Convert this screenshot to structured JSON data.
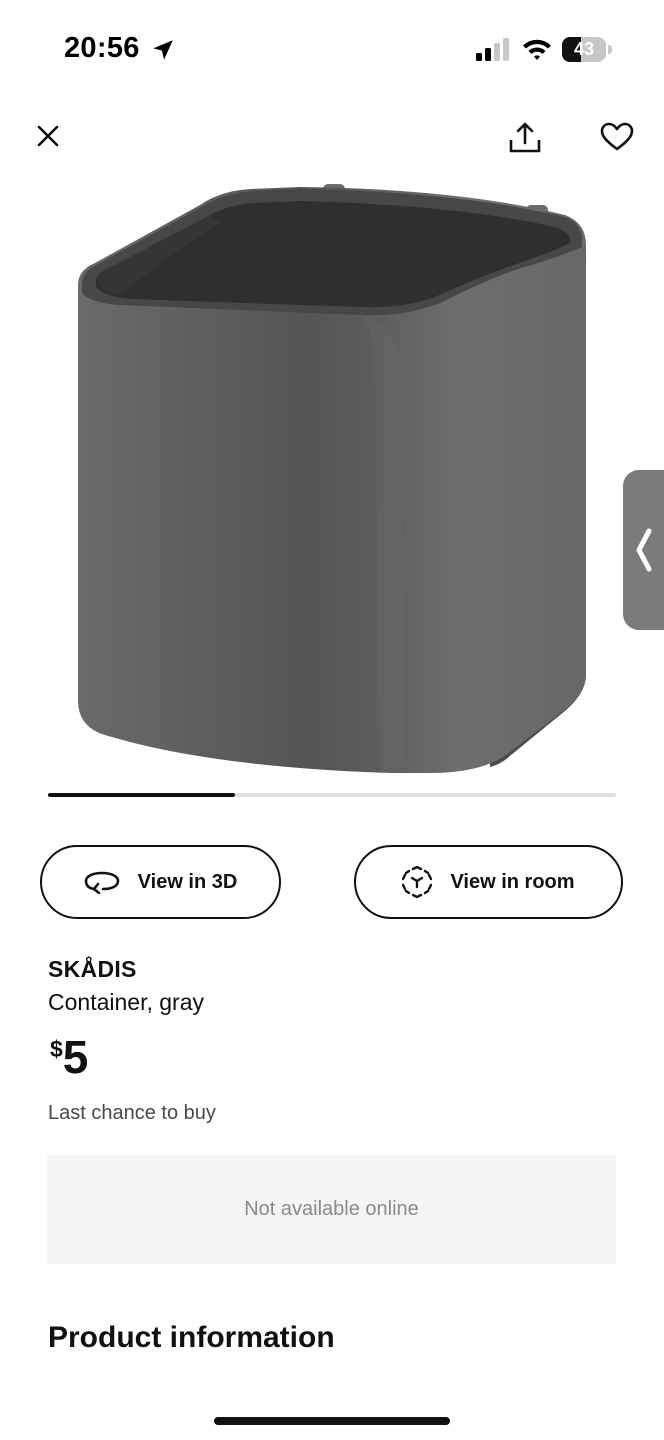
{
  "status_bar": {
    "time": "20:56",
    "battery_level": "43",
    "battery_fraction": 0.43
  },
  "header": {
    "icons": [
      "close-icon",
      "share-icon",
      "heart-icon"
    ]
  },
  "gallery": {
    "progress_fraction": 0.33
  },
  "actions": {
    "view_3d_label": "View in 3D",
    "view_room_label": "View in room"
  },
  "product": {
    "name": "SKÅDIS",
    "description": "Container, gray",
    "currency": "$",
    "price": "5",
    "notice": "Last chance to buy",
    "availability": "Not available online"
  },
  "sections": {
    "product_information": "Product information"
  },
  "colors": {
    "text": "#111111",
    "muted": "#8a8a8a",
    "panel": "#f5f5f5",
    "product_gray": "#5b5b5b"
  }
}
